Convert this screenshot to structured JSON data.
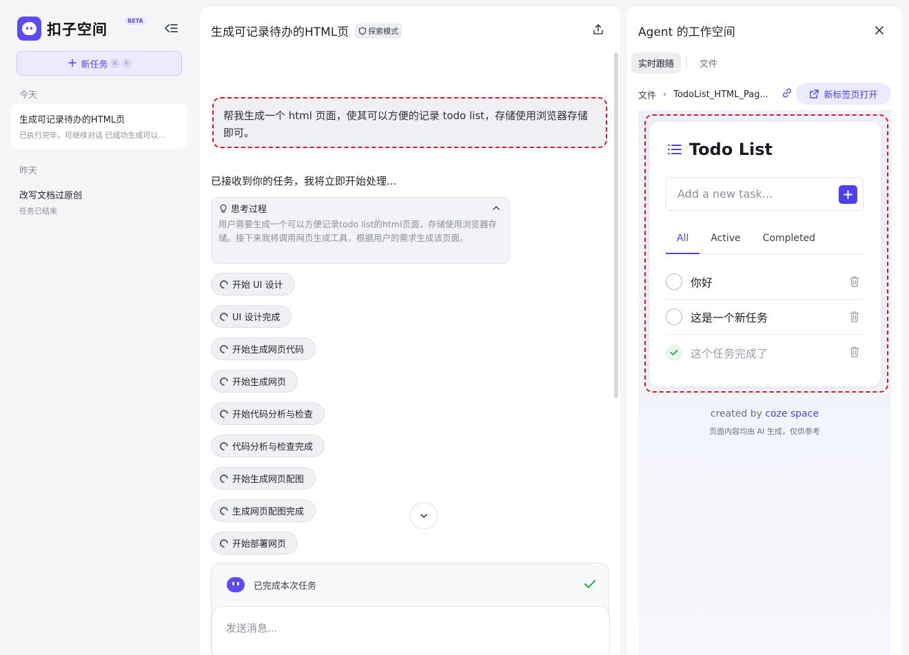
{
  "sidebar": {
    "app_name": "扣子空间",
    "beta_badge": "BETA",
    "new_task_label": "新任务",
    "new_task_shortcut": [
      "⌘",
      "K"
    ],
    "sections": [
      {
        "label": "今天",
        "items": [
          {
            "title": "生成可记录待办的HTML页",
            "subtitle": "已执行完毕，可继续对话 已成功生成可以...",
            "active": true
          }
        ]
      },
      {
        "label": "昨天",
        "items": [
          {
            "title": "改写文档过原创",
            "subtitle": "任务已结束",
            "active": false
          }
        ]
      }
    ]
  },
  "chat": {
    "title": "生成可记录待办的HTML页",
    "mode_badge": "探索模式",
    "user_message": "帮我生成一个 html 页面，使其可以方便的记录 todo list，存储使用浏览器存储即可。",
    "ack_text": "已接收到你的任务，我将立即开始处理...",
    "thinking": {
      "label": "思考过程",
      "body": "用户需要生成一个可以方便记录todo list的html页面，存储使用浏览器存储。接下来我将调用网页生成工具，根据用户的需求生成该页面。"
    },
    "steps": [
      "开始 UI 设计",
      "UI 设计完成",
      "开始生成网页代码",
      "开始生成网页",
      "开始代码分析与检查",
      "代码分析与检查完成",
      "开始生成网页配图",
      "生成网页配图完成",
      "开始部署网页"
    ],
    "status_text": "已完成本次任务",
    "input_placeholder": "发送消息..."
  },
  "workspace": {
    "title": "Agent 的工作空间",
    "tabs": [
      "实时跟随",
      "文件"
    ],
    "active_tab": "实时跟随",
    "breadcrumb_root": "文件",
    "breadcrumb_file": "TodoList_HTML_Pag...",
    "open_new_tab_label": "新标签页打开",
    "todo_app": {
      "title": "Todo List",
      "input_placeholder": "Add a new task...",
      "filters": [
        "All",
        "Active",
        "Completed"
      ],
      "active_filter": "All",
      "items": [
        {
          "text": "你好",
          "completed": false
        },
        {
          "text": "这是一个新任务",
          "completed": false
        },
        {
          "text": "这个任务完成了",
          "completed": true
        }
      ]
    },
    "credit_prefix": "created by",
    "credit_brand": "coze space",
    "credit_note": "页面内容均由 AI 生成，仅供参考"
  },
  "colors": {
    "accent": "#4b3ff0",
    "highlight_outline": "#e0151b",
    "done_check": "#22a34a"
  }
}
